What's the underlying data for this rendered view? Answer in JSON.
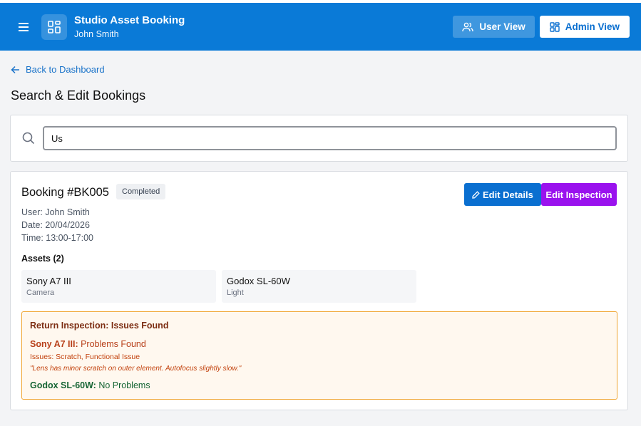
{
  "header": {
    "app_title": "Studio Asset Booking",
    "user_name": "John Smith",
    "user_view_label": "User View",
    "admin_view_label": "Admin View",
    "colors": {
      "bar": "#0a7ad7"
    }
  },
  "nav": {
    "back_label": "Back to Dashboard"
  },
  "page": {
    "title": "Search & Edit Bookings"
  },
  "search": {
    "value": "Us",
    "placeholder": ""
  },
  "booking": {
    "title": "Booking #BK005",
    "status": "Completed",
    "user_line": "User: John Smith",
    "date_line": "Date: 20/04/2026",
    "time_line": "Time: 13:00-17:00",
    "edit_details_label": "Edit Details",
    "edit_inspection_label": "Edit Inspection",
    "assets_heading": "Assets (2)",
    "assets": [
      {
        "name": "Sony A7 III",
        "type": "Camera"
      },
      {
        "name": "Godox SL-60W",
        "type": "Light"
      }
    ],
    "inspection": {
      "title": "Return Inspection: Issues Found",
      "items": [
        {
          "name": "Sony A7 III:",
          "result": "Problems Found",
          "issues": "Issues: Scratch, Functional Issue",
          "note": "\"Lens has minor scratch on outer element. Autofocus slightly slow.\""
        },
        {
          "name": "Godox SL-60W:",
          "result": "No Problems"
        }
      ]
    }
  }
}
